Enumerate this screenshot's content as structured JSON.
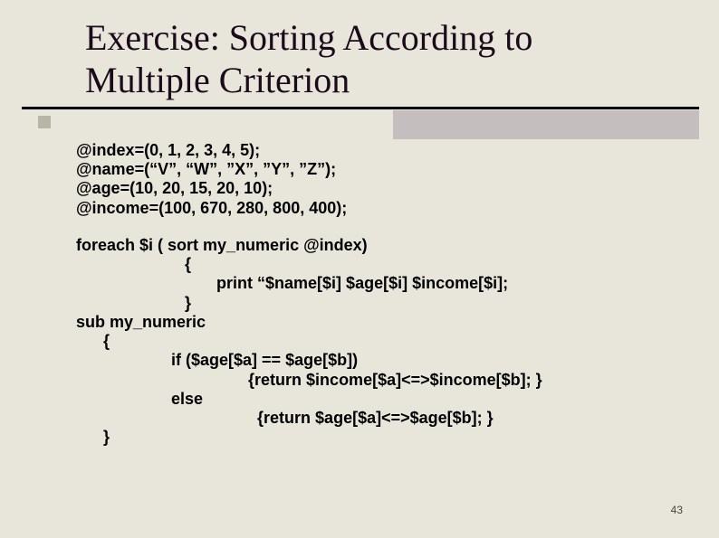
{
  "title": "Exercise: Sorting According to\nMultiple Criterion",
  "code": {
    "l1": "@index=(0, 1, 2, 3, 4, 5);",
    "l2": "@name=(“V”, “W”, ”X”, ”Y”, ”Z”);",
    "l3": "@age=(10, 20, 15, 20, 10);",
    "l4": "@income=(100, 670, 280, 800, 400);",
    "l5": "foreach $i ( sort my_numeric @index)",
    "l6": "                        {",
    "l7": "                               print “$name[$i] $age[$i] $income[$i];",
    "l8": "                        }",
    "l9": "sub my_numeric",
    "l10": "      {",
    "l11": "                     if ($age[$a] == $age[$b])",
    "l12": "                                      {return $income[$a]<=>$income[$b]; }",
    "l13": "                     else",
    "l14": "                                        {return $age[$a]<=>$age[$b]; }",
    "l15": "      }"
  },
  "page_number": "43"
}
